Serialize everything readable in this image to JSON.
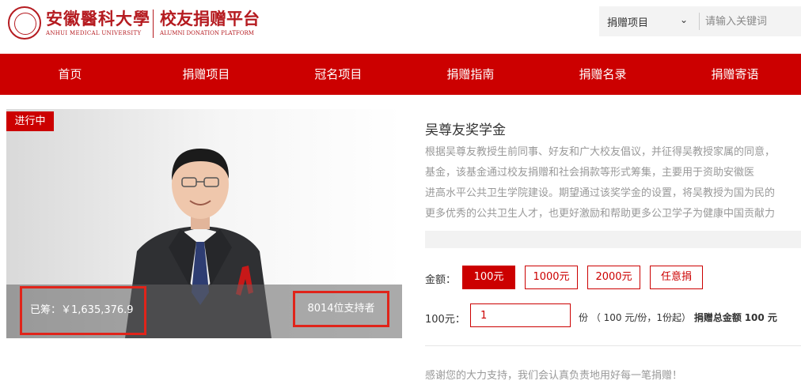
{
  "header": {
    "logo_cn": "安徽醫科大學",
    "logo_en": "ANHUI MEDICAL UNIVERSITY",
    "platform_cn": "校友捐赠平台",
    "platform_en": "ALUMNI DONATION PLATFORM"
  },
  "search": {
    "category": "捐赠项目",
    "placeholder": "请输入关键词"
  },
  "nav": {
    "items": [
      "首页",
      "捐赠项目",
      "冠名项目",
      "捐赠指南",
      "捐赠名录",
      "捐赠寄语"
    ]
  },
  "hero": {
    "status_badge": "进行中",
    "raised": "已筹：￥1,635,376.9",
    "supporters": "8014位支持者"
  },
  "project": {
    "title": "吴尊友奖学金",
    "description": [
      "根据吴尊友教授生前同事、好友和广大校友倡议，并征得吴教授家属的同意，",
      "基金，该基金通过校友捐赠和社会捐款等形式筹集，主要用于资助安徽医",
      "进高水平公共卫生学院建设。期望通过该奖学金的设置，将吴教授为国为民的",
      "更多优秀的公共卫生人才，也更好激励和帮助更多公卫学子为健康中国贡献力"
    ]
  },
  "donation": {
    "amount_label": "金额：",
    "options": [
      "100元",
      "1000元",
      "2000元",
      "任意捐"
    ],
    "selected": "100元",
    "qty_label": "100元：",
    "qty_value": "1",
    "unit_text": "份 （ 100 元/份，1份起）",
    "total_label": "捐赠总金额",
    "total_value": "100 元",
    "thanks": "感谢您的大力支持，我们会认真负责地用好每一笔捐赠！"
  },
  "colors": {
    "brand_red": "#cc0000",
    "highlight_box": "#e0241a"
  }
}
